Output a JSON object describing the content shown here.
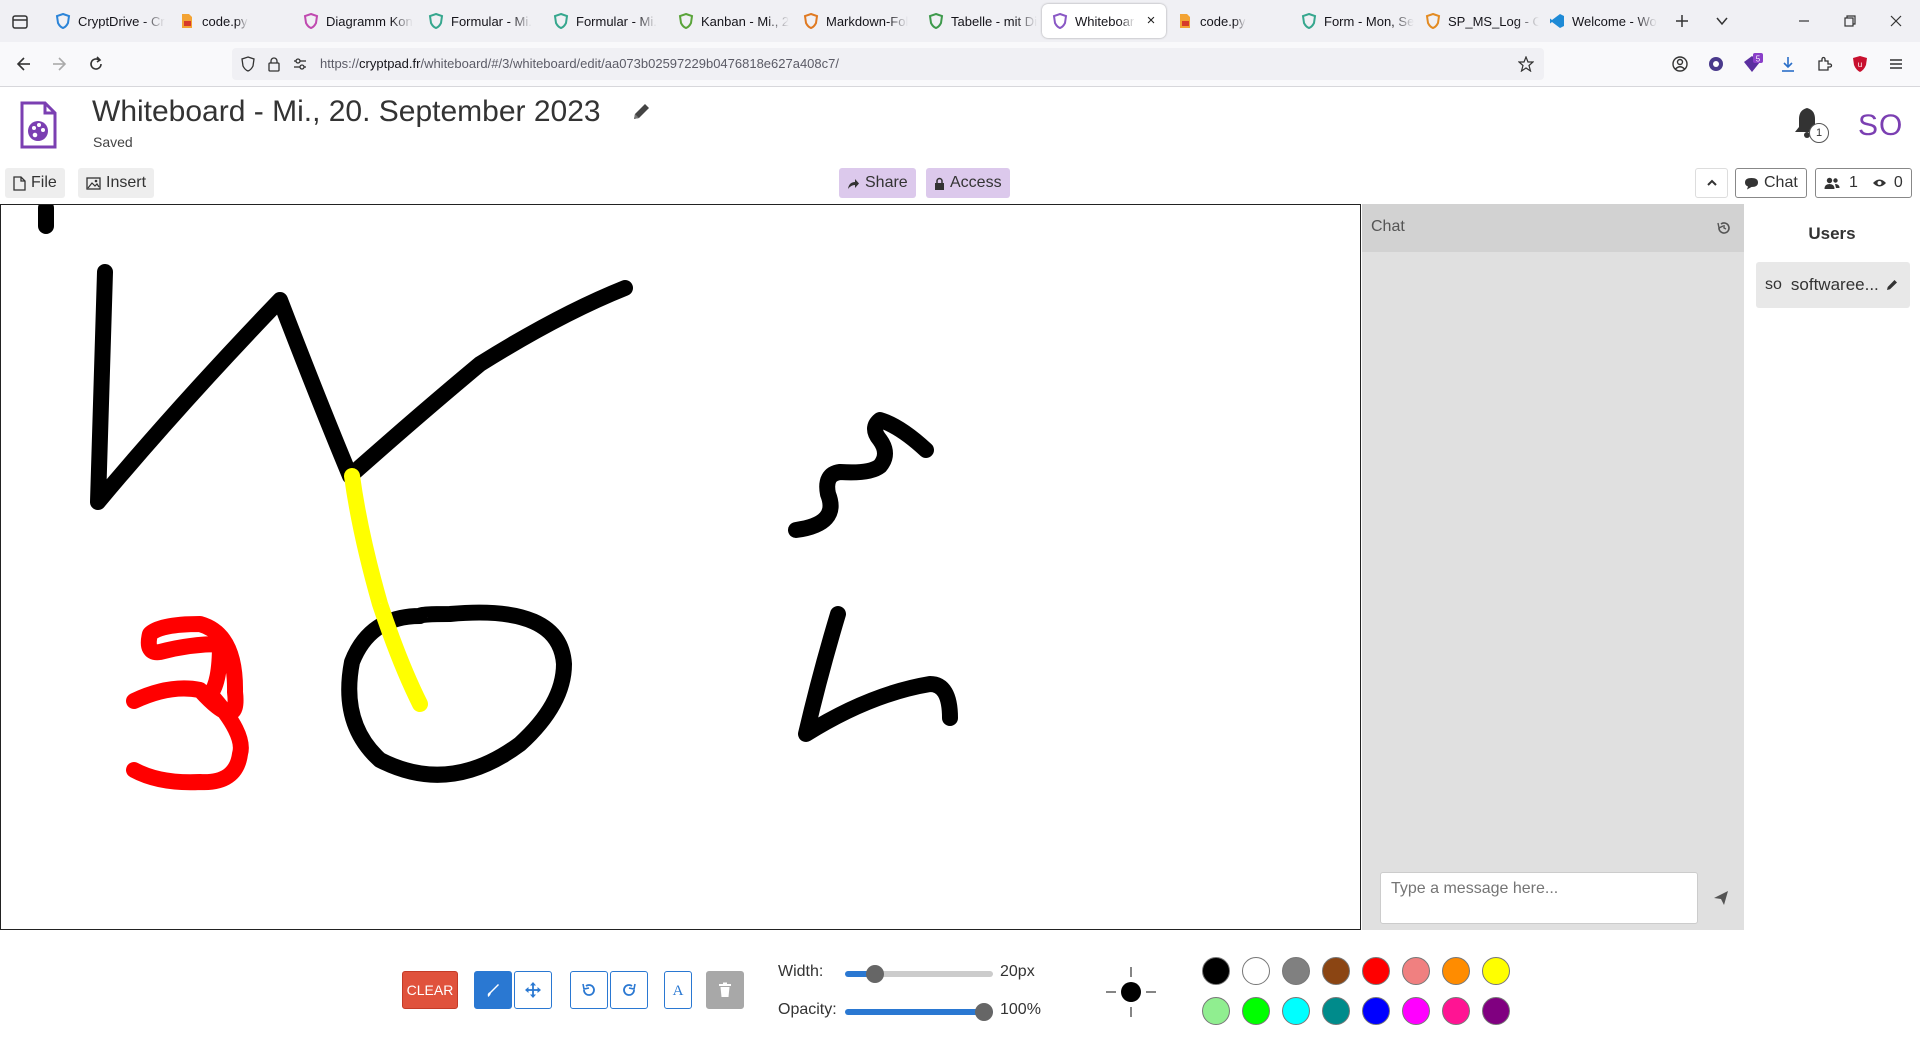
{
  "browser": {
    "tabs": [
      {
        "label": "CryptDrive - Cr",
        "icon": "cryptpad-shield-icon",
        "color": "#2b84d8"
      },
      {
        "label": "code.py",
        "icon": "code-file-icon",
        "color": "#f3a333"
      },
      {
        "label": "Diagramm Kon",
        "icon": "diagram-shield-icon",
        "color": "#c04ab0"
      },
      {
        "label": "Formular - Mi.",
        "icon": "form-shield-icon",
        "color": "#36a78e"
      },
      {
        "label": "Formular - Mi.",
        "icon": "form-shield-icon",
        "color": "#36a78e"
      },
      {
        "label": "Kanban - Mi., 2",
        "icon": "kanban-shield-icon",
        "color": "#5aa43a"
      },
      {
        "label": "Markdown-Fol",
        "icon": "markdown-shield-icon",
        "color": "#e07a22"
      },
      {
        "label": "Tabelle - mit Di",
        "icon": "sheet-shield-icon",
        "color": "#3e9a4c"
      },
      {
        "label": "Whiteboard",
        "icon": "whiteboard-shield-icon",
        "color": "#8a58c5",
        "active": true
      },
      {
        "label": "code.py",
        "icon": "code-file-icon",
        "color": "#f3a333"
      },
      {
        "label": "Form - Mon, Se",
        "icon": "form-shield-icon",
        "color": "#36a78e"
      },
      {
        "label": "SP_MS_Log - C",
        "icon": "code-shield-icon",
        "color": "#e38b22"
      },
      {
        "label": "Welcome - Wo",
        "icon": "vscode-icon",
        "color": "#1e8ad6"
      }
    ],
    "tab_close": "×",
    "url_prefix": "https://",
    "url_host": "cryptpad.fr",
    "url_path": "/whiteboard/#/3/whiteboard/edit/aa073b02597229b0476818e627a408c7/",
    "extension_badge": "5"
  },
  "app": {
    "title": "Whiteboard - Mi., 20. September 2023",
    "status": "Saved",
    "notifications_count": "1",
    "user_initials": "SO",
    "brand_color": "#7b3fb2"
  },
  "toolbar": {
    "file_label": "File",
    "insert_label": "Insert",
    "share_label": "Share",
    "access_label": "Access",
    "chat_label": "Chat",
    "users_count": "1",
    "viewers_count": "0"
  },
  "chat": {
    "title": "Chat",
    "placeholder": "Type a message here..."
  },
  "users": {
    "title": "Users",
    "list": [
      {
        "initials": "so",
        "name": "softwaree..."
      }
    ]
  },
  "tools": {
    "clear_label": "CLEAR",
    "width_label": "Width:",
    "width_value_label": "20px",
    "width_fraction": 0.2,
    "opacity_label": "Opacity:",
    "opacity_value_label": "100%",
    "opacity_fraction": 1.0,
    "palette": [
      "#000000",
      "#ffffff",
      "#808080",
      "#8b4513",
      "#ff0000",
      "#f08080",
      "#ff8c00",
      "#ffff00",
      "#90ee90",
      "#00ff00",
      "#00ffff",
      "#008b8b",
      "#0000ff",
      "#ff00ff",
      "#ff1493",
      "#800080"
    ]
  }
}
